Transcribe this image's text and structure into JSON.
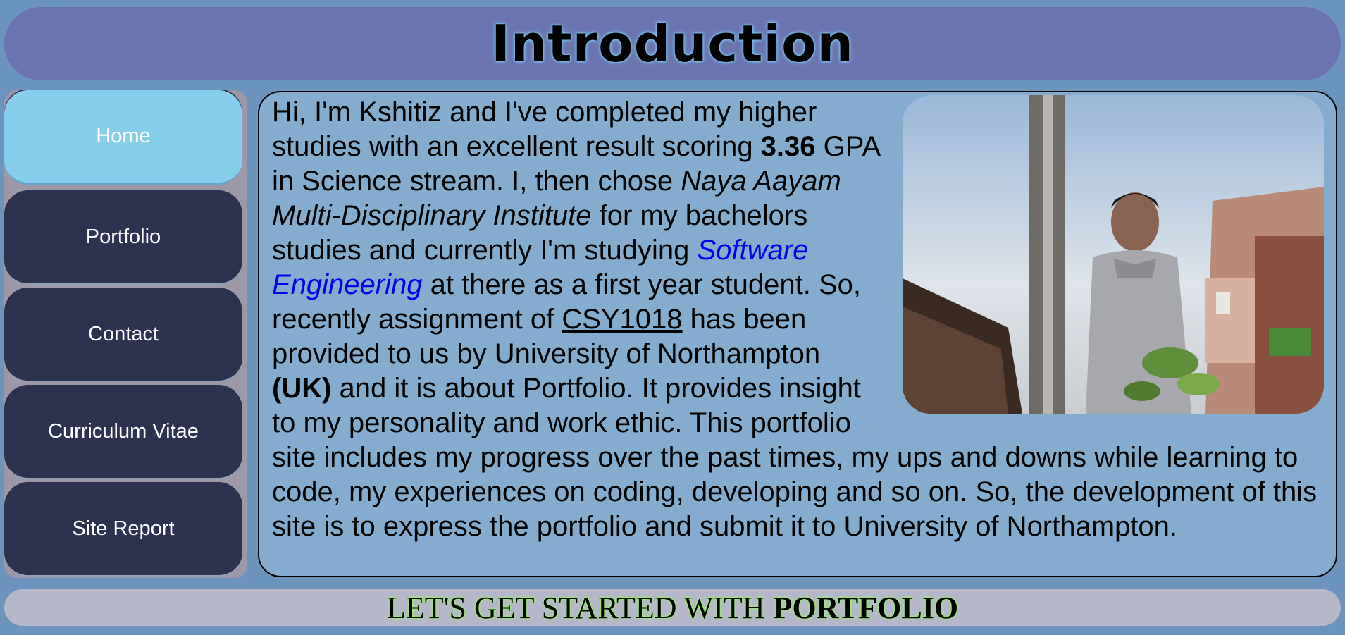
{
  "header": {
    "title": "Introduction"
  },
  "sidebar": {
    "items": [
      {
        "label": "Home",
        "active": true
      },
      {
        "label": "Portfolio"
      },
      {
        "label": "Contact"
      },
      {
        "label": "Curriculum Vitae"
      },
      {
        "label": "Site Report"
      }
    ]
  },
  "intro": {
    "p1": "Hi, I'm Kshitiz and I've completed my higher studies with an excellent result scoring ",
    "gpa": "3.36",
    "p2": " GPA in Science stream. I, then chose ",
    "institute": "Naya Aayam Multi-Disciplinary Institute",
    "p3": " for my bachelors studies and currently I'm studying ",
    "course": "Software Engineering",
    "p4": " at there as a first year student. So, recently assignment of ",
    "module": "CSY1018",
    "p5": " has been provided to us by University of Northampton ",
    "country": "(UK)",
    "p6": " and it is about Portfolio. It provides insight to my personality and work ethic. This portfolio site includes my progress over the past times, my ups and downs while learning to code, my experiences on coding, developing and so on. So, the development of this site is to express the portfolio and submit it to University of Northampton."
  },
  "footer": {
    "text": "LET'S GET STARTED WITH",
    "emphasis": "PORTFOLIO"
  },
  "colors": {
    "page_bg": "#6b95bd",
    "header_bg": "#6a75b0",
    "nav_bg": "#2c3250",
    "nav_active": "#87ceea",
    "content_bg": "#84accf",
    "link": "#0000ee",
    "footer_bg": "#b7b7cc"
  }
}
